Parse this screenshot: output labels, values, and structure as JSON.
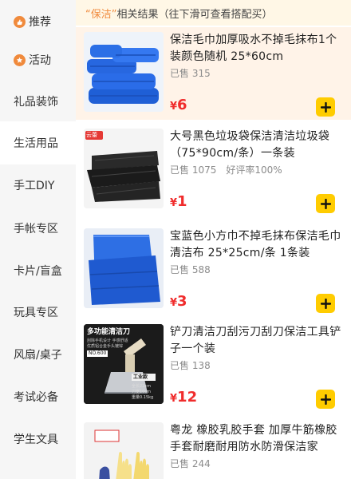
{
  "sidebar": {
    "items": [
      {
        "label": "推荐",
        "icon": "thumb-up-icon"
      },
      {
        "label": "活动",
        "icon": "star-icon"
      },
      {
        "label": "礼品装饰"
      },
      {
        "label": "生活用品"
      },
      {
        "label": "手工DIY"
      },
      {
        "label": "手帐专区"
      },
      {
        "label": "卡片/盲盒"
      },
      {
        "label": "玩具专区"
      },
      {
        "label": "风扇/桌子"
      },
      {
        "label": "考试必备"
      },
      {
        "label": "学生文具"
      }
    ]
  },
  "search_header": {
    "keyword": "“保洁”",
    "suffix": "相关结果（往下滑可查看搭配买）"
  },
  "products": [
    {
      "title": "保洁毛巾加厚吸水不掉毛抹布1个装颜色随机 25*60cm",
      "sold": "已售 315",
      "rating": "",
      "currency": "¥",
      "price": "6",
      "thumb": "blue-towels-photo"
    },
    {
      "title": "大号黑色垃圾袋保洁清洁垃圾袋（75*90cm/条）一条装",
      "sold": "已售 1075",
      "rating": "好评率100%",
      "currency": "¥",
      "price": "1",
      "thumb": "black-trash-bags-photo",
      "thumb_badge": "云蕾"
    },
    {
      "title": "宝蓝色小方巾不掉毛抹布保洁毛巾清洁布 25*25cm/条 1条装",
      "sold": "已售 588",
      "rating": "",
      "currency": "¥",
      "price": "3",
      "thumb": "blue-cloth-photo"
    },
    {
      "title": "铲刀清洁刀刮污刀刮刀保洁工具铲子一个装",
      "sold": "已售 138",
      "rating": "",
      "currency": "¥",
      "price": "12",
      "thumb": "scraper-tool-photo",
      "thumb_texts": {
        "headline": "多功能清洁刀",
        "sub1": "刮除手机设计 手感舒适",
        "sub2": "优质铝合金手头镀锌",
        "model": "NO.600",
        "tag": "工业款",
        "spec1": "全长22cm",
        "spec2": "刀宽10cm",
        "spec3": "重量0.15kg"
      }
    },
    {
      "title": "粤龙 橡胶乳胶手套 加厚牛筋橡胶手套耐磨耐用防水防滑保洁家",
      "sold": "已售 244",
      "rating": "",
      "currency": "",
      "price": "",
      "thumb": "yellow-gloves-photo"
    }
  ],
  "colors": {
    "accent": "#f08a3c",
    "price": "#f02c2c",
    "cart_button": "#ffcc00",
    "highlight_row": "#fff3e8"
  }
}
